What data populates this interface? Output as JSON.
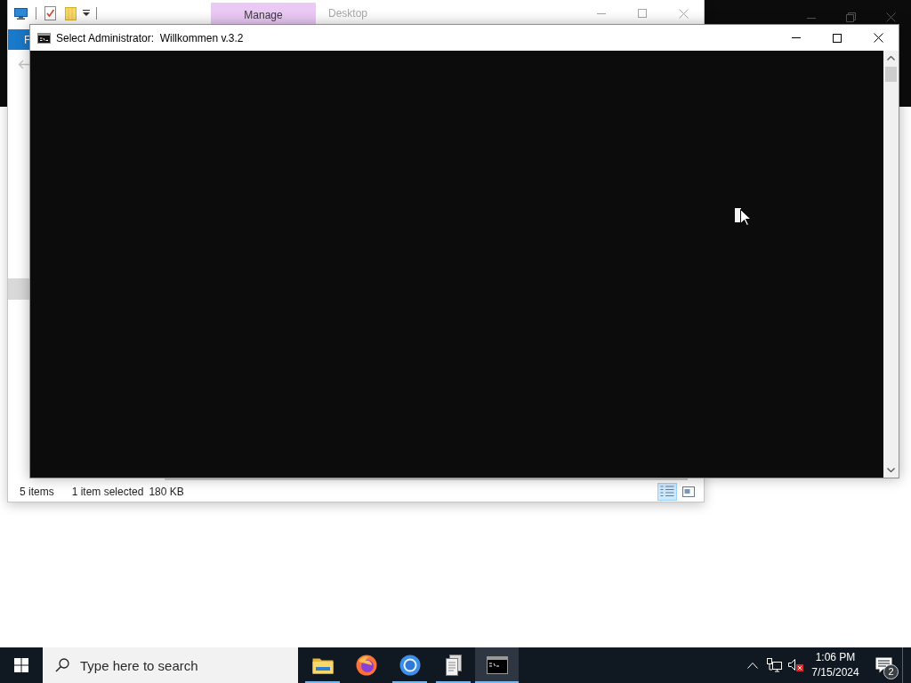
{
  "explorer": {
    "title_bar": {
      "contextual_tab": "Manage",
      "title": "Desktop"
    },
    "ribbon": {
      "file_tab": "F"
    },
    "status_bar": {
      "item_count": "5 items",
      "selection": "1 item selected",
      "size": "180 KB",
      "view_buttons": [
        {
          "kind": "details",
          "selected": true
        },
        {
          "kind": "large-icons",
          "selected": false
        }
      ]
    }
  },
  "console": {
    "title": "Select Administrator:  Willkommen v.3.2"
  },
  "taskbar": {
    "search": {
      "placeholder": "Type here to search"
    },
    "apps": [
      {
        "kind": "folder",
        "running": true,
        "selected": false
      },
      {
        "kind": "globe",
        "running": false,
        "selected": false
      },
      {
        "kind": "ring",
        "running": true,
        "selected": false
      },
      {
        "kind": "documents",
        "running": true,
        "selected": false
      },
      {
        "kind": "terminal",
        "running": true,
        "selected": true
      }
    ],
    "tray": {
      "volume": {
        "muted": true
      },
      "clock": {
        "time": "1:06 PM",
        "date": "7/15/2024"
      },
      "notifications": {
        "count": "2"
      }
    }
  }
}
